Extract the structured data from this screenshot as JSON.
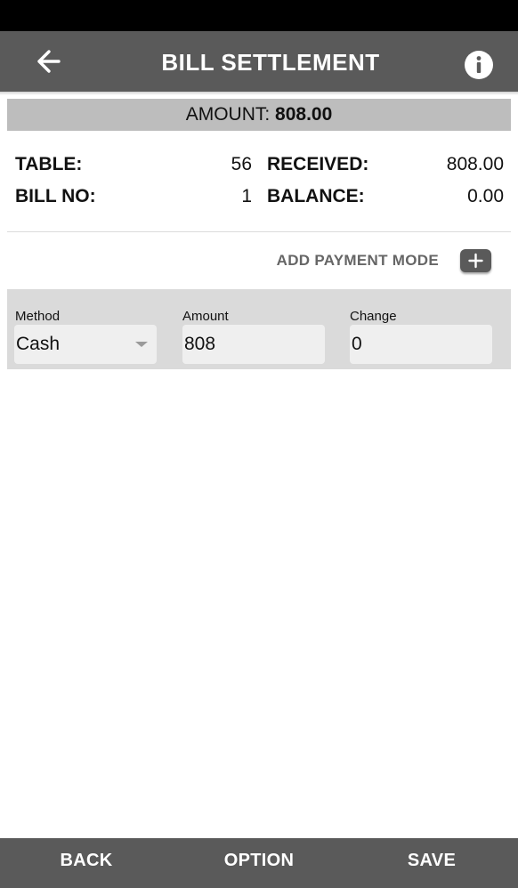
{
  "header": {
    "title": "BILL SETTLEMENT",
    "back_icon": "arrow-left-icon",
    "info_icon": "info-icon"
  },
  "amount_banner": {
    "label": "AMOUNT:",
    "value": "808.00"
  },
  "bill_info": {
    "table_label": "TABLE:",
    "table_value": "56",
    "bill_no_label": "BILL NO:",
    "bill_no_value": "1",
    "received_label": "RECEIVED:",
    "received_value": "808.00",
    "balance_label": "BALANCE:",
    "balance_value": "0.00"
  },
  "add_payment": {
    "label": "ADD PAYMENT MODE",
    "icon": "plus-icon"
  },
  "payment_row": {
    "method_label": "Method",
    "method_value": "Cash",
    "amount_label": "Amount",
    "amount_value": "808",
    "change_label": "Change",
    "change_value": "0"
  },
  "footer": {
    "back_label": "BACK",
    "option_label": "OPTION",
    "save_label": "SAVE"
  },
  "colors": {
    "app_bar": "#5a5a5a",
    "banner": "#bdbdbd",
    "panel": "#dadada",
    "field": "#efefef"
  }
}
